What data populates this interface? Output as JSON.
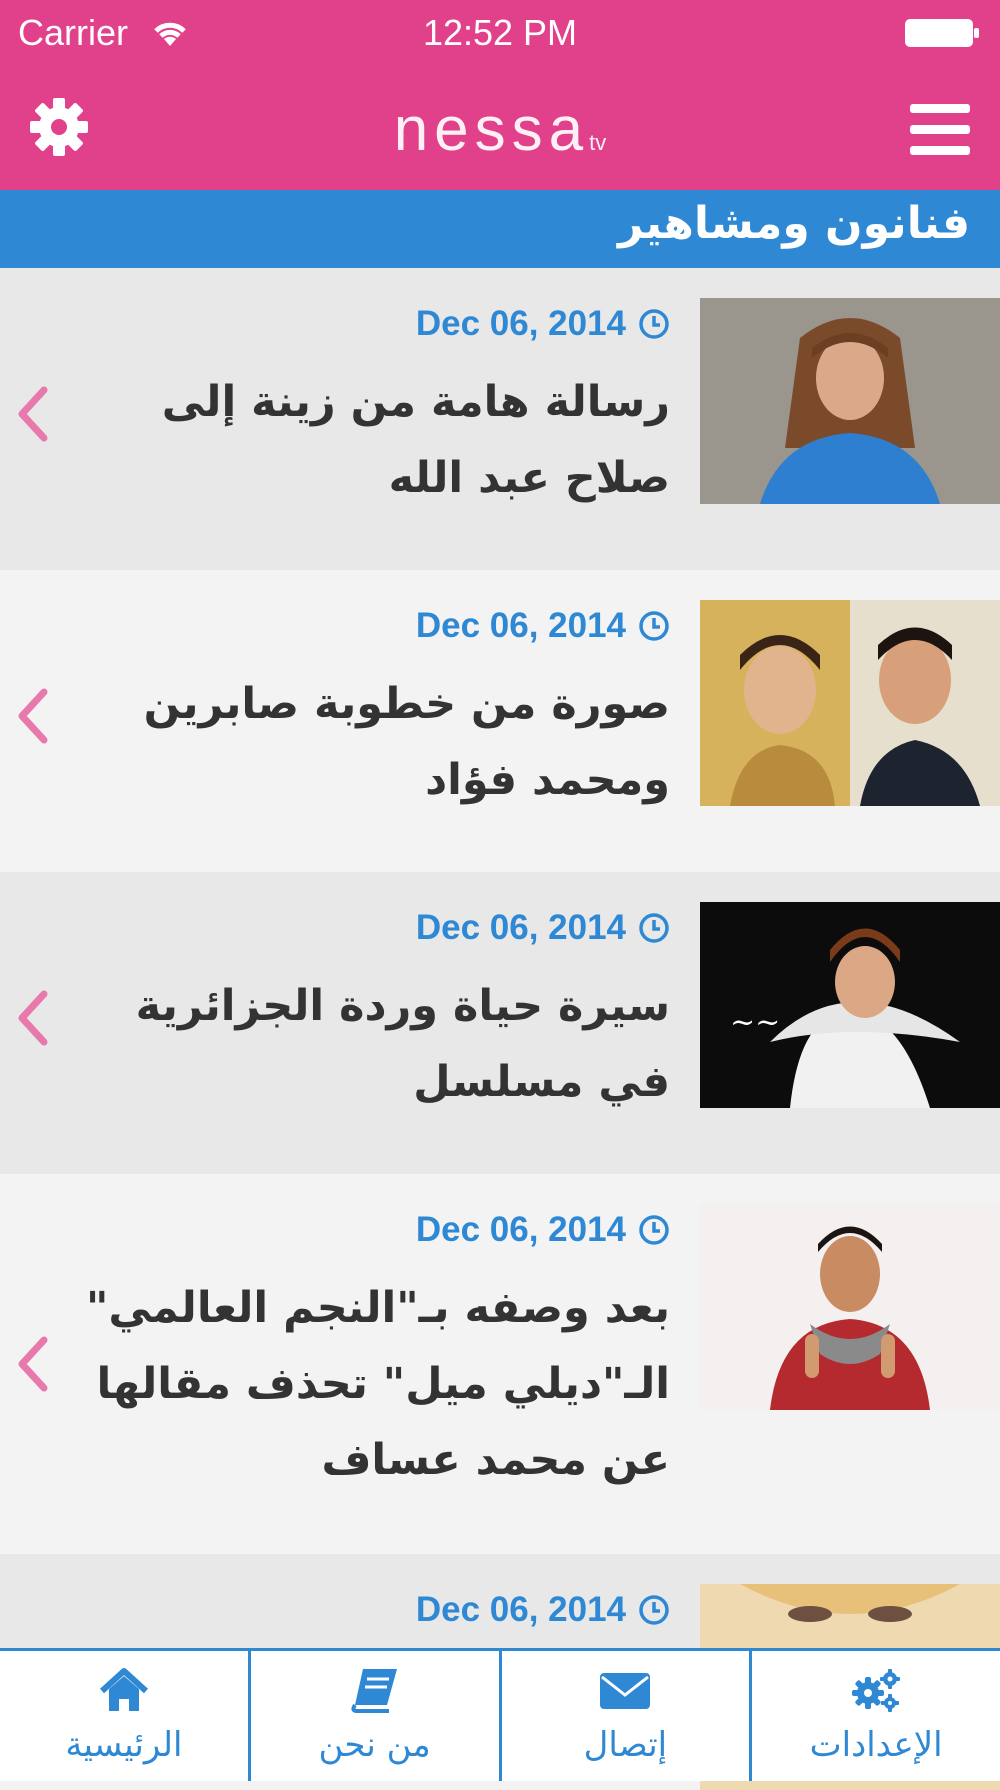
{
  "status_bar": {
    "carrier": "Carrier",
    "time": "12:52 PM"
  },
  "nav": {
    "logo": "nessa",
    "logo_suffix": "tv"
  },
  "category": {
    "title": "فنانون ومشاهير"
  },
  "articles": [
    {
      "date": "Dec 06, 2014",
      "title": "رسالة هامة من زينة إلى صلاح عبد الله"
    },
    {
      "date": "Dec 06, 2014",
      "title": "صورة من خطوبة صابرين ومحمد فؤاد"
    },
    {
      "date": "Dec 06, 2014",
      "title": "سيرة حياة وردة الجزائرية في مسلسل"
    },
    {
      "date": "Dec 06, 2014",
      "title": "بعد وصفه بـ\"النجم العالمي\" الـ\"ديلي ميل\" تحذف مقالها عن محمد عساف"
    },
    {
      "date": "Dec 06, 2014",
      "title": ""
    }
  ],
  "tabs": {
    "home": "الرئيسية",
    "about": "من نحن",
    "contact": "إتصال",
    "settings": "الإعدادات"
  },
  "colors": {
    "brand_pink": "#e0418a",
    "accent_blue": "#2e88d4",
    "chevron_pink": "#e879ac"
  }
}
